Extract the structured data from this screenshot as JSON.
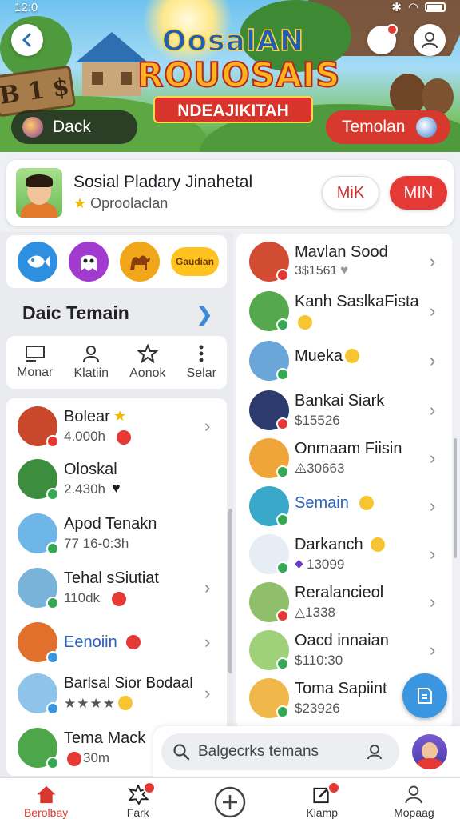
{
  "status_bar": {
    "time": "12:0",
    "carrier_icons": "Ⓔ"
  },
  "hero": {
    "logo_line1": "OosalAN",
    "logo_line2": "ROUOSAIS",
    "logo_ribbon": "NDEAJIKITAH",
    "sign_text": "B 1 $",
    "back_pill_label": "Dack",
    "action_pill_label": "Temolan"
  },
  "profile": {
    "name": "Sosial Pladary Jinahetal",
    "subtitle": "Oproolaclan",
    "btn_secondary": "MiK",
    "btn_primary": "MIN"
  },
  "apps": {
    "pill_label": "Gaudian"
  },
  "section": {
    "title": "Daic Temain"
  },
  "tools": [
    {
      "label": "Monar"
    },
    {
      "label": "Klatiin"
    },
    {
      "label": "Aonok"
    },
    {
      "label": "Selar"
    }
  ],
  "left_list": [
    {
      "name": "Bolear",
      "sub": "4.000h",
      "chev": true
    },
    {
      "name": "Oloskal",
      "sub": "2.430h",
      "chev": false
    },
    {
      "name": "Apod Tenakn",
      "sub": "77 16-0:3h",
      "chev": false
    },
    {
      "name": "Tehal sSiutiat",
      "sub": "110dk",
      "chev": true
    },
    {
      "name": "Eenoiin",
      "sub": "",
      "chev": true
    },
    {
      "name": "Barlsal Sior Bodaal",
      "sub": "★★★★",
      "chev": true
    },
    {
      "name": "Tema Mack",
      "sub": "30m",
      "chev": false
    }
  ],
  "right_list": [
    {
      "name": "Mavlan Sood",
      "sub": "3$1561"
    },
    {
      "name": "Kanh SaslkaFista",
      "sub": ""
    },
    {
      "name": "Mueka",
      "sub": ""
    },
    {
      "name": "Bankai Siark",
      "sub": "$15526"
    },
    {
      "name": "Onmaam Fiisin",
      "sub": "⨹30663"
    },
    {
      "name": "Semain",
      "sub": ""
    },
    {
      "name": "Darkanch",
      "sub": "13099"
    },
    {
      "name": "Reralancieol",
      "sub": "△1338"
    },
    {
      "name": "Oacd innaian",
      "sub": "$110:30"
    },
    {
      "name": "Toma Sapiint",
      "sub": "$23926"
    }
  ],
  "search": {
    "placeholder": "Balgecrks temans"
  },
  "bottom_nav": [
    {
      "label": "Berolbay",
      "active": true
    },
    {
      "label": "Fark",
      "active": false
    },
    {
      "label": "",
      "active": false
    },
    {
      "label": "Klamp",
      "active": false
    },
    {
      "label": "Mopaag",
      "active": false
    }
  ],
  "colors": {
    "accent_red": "#e53935",
    "accent_blue": "#3a96e0",
    "online_green": "#34a853"
  }
}
